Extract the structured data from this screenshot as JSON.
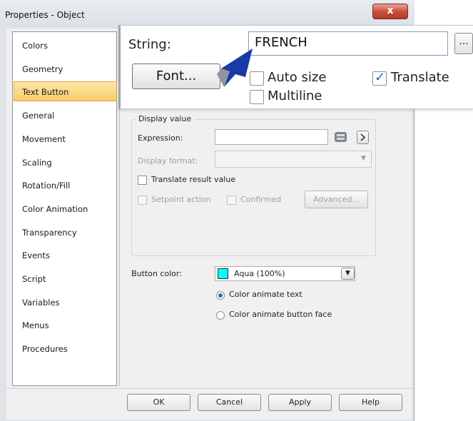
{
  "window": {
    "title": "Properties - Object",
    "close_glyph": "x"
  },
  "categories": [
    {
      "label": "Colors"
    },
    {
      "label": "Geometry"
    },
    {
      "label": "Text Button",
      "selected": true
    },
    {
      "label": "General"
    },
    {
      "label": "Movement"
    },
    {
      "label": "Scaling"
    },
    {
      "label": "Rotation/Fill"
    },
    {
      "label": "Color Animation"
    },
    {
      "label": "Transparency"
    },
    {
      "label": "Events"
    },
    {
      "label": "Script"
    },
    {
      "label": "Variables"
    },
    {
      "label": "Menus"
    },
    {
      "label": "Procedures"
    }
  ],
  "callout": {
    "string_label": "String:",
    "string_value": "FRENCH",
    "ellipsis_label": "...",
    "font_button": "Font...",
    "auto_size": {
      "label": "Auto size",
      "checked": false
    },
    "translate": {
      "label": "Translate",
      "checked": true
    },
    "multiline": {
      "label": "Multiline",
      "checked": false
    }
  },
  "display_value": {
    "legend": "Display value",
    "expression_label": "Expression:",
    "expression_value": "",
    "display_format_label": "Display format:",
    "translate_result": {
      "label": "Translate result value",
      "checked": false
    },
    "setpoint_action": {
      "label": "Setpoint action",
      "checked": false
    },
    "confirmed": {
      "label": "Confirmed",
      "checked": false
    },
    "advanced_button": "Advanced..."
  },
  "button_color": {
    "label": "Button color:",
    "value": "Aqua (100%)",
    "swatch": "#00ffff"
  },
  "radio": {
    "animate_text": {
      "label": "Color animate text",
      "selected": true
    },
    "animate_face": {
      "label": "Color animate button face",
      "selected": false
    }
  },
  "footer": {
    "ok": "OK",
    "cancel": "Cancel",
    "apply": "Apply",
    "help": "Help"
  },
  "icons": {
    "arrow_pointer": "arrow-pointer-icon",
    "expression_browse": "tag-browse-icon",
    "expression_next": "chevron-right-icon",
    "dropdown": "chevron-down-icon",
    "checkmark": "check-icon"
  },
  "colors": {
    "selected_bg": "#fbcd6a",
    "arrow": "#1a3aa6",
    "check": "#2a63c7"
  }
}
